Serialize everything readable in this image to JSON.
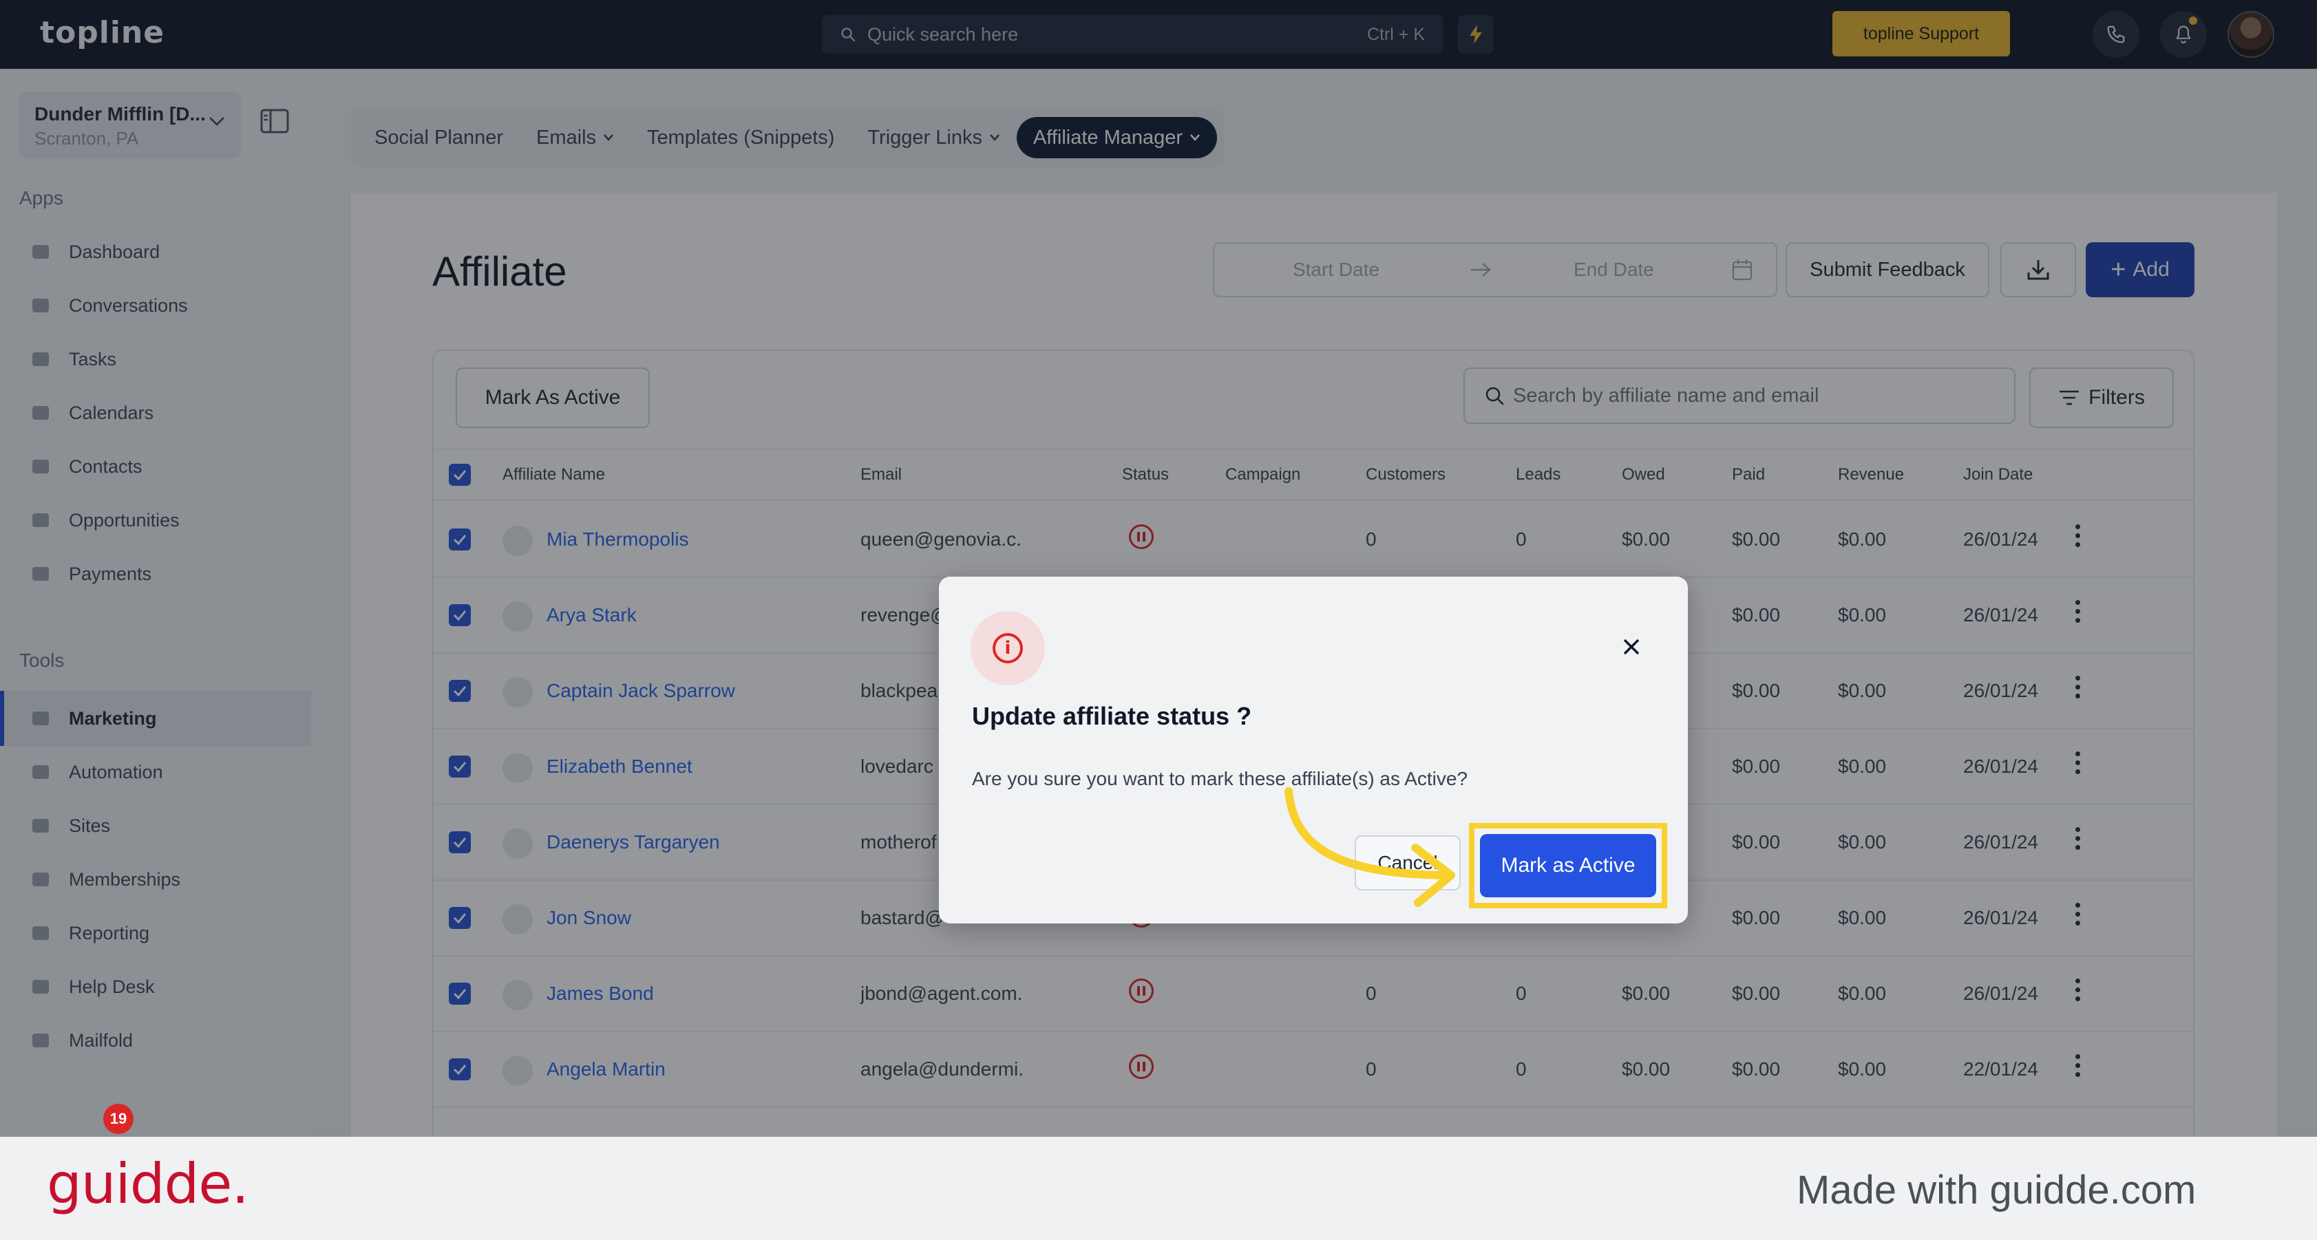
{
  "topbar": {
    "logo": "topline",
    "search_placeholder": "Quick search here",
    "search_shortcut": "Ctrl + K",
    "support_label": "topline Support"
  },
  "sidebar": {
    "org_name": "Dunder Mifflin [D...",
    "org_location": "Scranton, PA",
    "apps_heading": "Apps",
    "apps": [
      {
        "label": "Dashboard",
        "icon": "dashboard-icon"
      },
      {
        "label": "Conversations",
        "icon": "conversations-icon"
      },
      {
        "label": "Tasks",
        "icon": "tasks-icon"
      },
      {
        "label": "Calendars",
        "icon": "calendar-icon"
      },
      {
        "label": "Contacts",
        "icon": "contacts-icon"
      },
      {
        "label": "Opportunities",
        "icon": "opportunities-icon"
      },
      {
        "label": "Payments",
        "icon": "payments-icon"
      }
    ],
    "tools_heading": "Tools",
    "tools": [
      {
        "label": "Marketing",
        "icon": "megaphone-icon",
        "active": true
      },
      {
        "label": "Automation",
        "icon": "automation-icon"
      },
      {
        "label": "Sites",
        "icon": "sites-icon"
      },
      {
        "label": "Memberships",
        "icon": "memberships-icon"
      },
      {
        "label": "Reporting",
        "icon": "reporting-icon"
      },
      {
        "label": "Help Desk",
        "icon": "help-icon"
      },
      {
        "label": "Mailfold",
        "icon": "mailfold-icon"
      }
    ],
    "notification_count": "19"
  },
  "subnav": {
    "tabs": [
      {
        "label": "Social Planner",
        "dropdown": false
      },
      {
        "label": "Emails",
        "dropdown": true
      },
      {
        "label": "Templates (Snippets)",
        "dropdown": false
      },
      {
        "label": "Trigger Links",
        "dropdown": true
      },
      {
        "label": "Affiliate Manager",
        "dropdown": true,
        "active": true
      }
    ]
  },
  "page": {
    "title": "Affiliate",
    "start_date_placeholder": "Start Date",
    "end_date_placeholder": "End Date",
    "submit_feedback": "Submit Feedback",
    "add_label": "Add",
    "mark_active_button": "Mark As Active",
    "search_placeholder": "Search by affiliate name and email",
    "filters_label": "Filters"
  },
  "table": {
    "columns": [
      "Affiliate Name",
      "Email",
      "Status",
      "Campaign",
      "Customers",
      "Leads",
      "Owed",
      "Paid",
      "Revenue",
      "Join Date"
    ],
    "rows": [
      {
        "name": "Mia Thermopolis",
        "email": "queen@genovia.c.",
        "customers": "0",
        "leads": "0",
        "owed": "$0.00",
        "paid": "$0.00",
        "revenue": "$0.00",
        "join_date": "26/01/24"
      },
      {
        "name": "Arya Stark",
        "email": "revenge@",
        "customers": "",
        "leads": "",
        "owed": "",
        "paid": "$0.00",
        "revenue": "$0.00",
        "join_date": "26/01/24"
      },
      {
        "name": "Captain Jack Sparrow",
        "email": "blackpea",
        "customers": "",
        "leads": "",
        "owed": "",
        "paid": "$0.00",
        "revenue": "$0.00",
        "join_date": "26/01/24"
      },
      {
        "name": "Elizabeth Bennet",
        "email": "lovedarc",
        "customers": "",
        "leads": "",
        "owed": "",
        "paid": "$0.00",
        "revenue": "$0.00",
        "join_date": "26/01/24"
      },
      {
        "name": "Daenerys Targaryen",
        "email": "motherof",
        "customers": "",
        "leads": "",
        "owed": "",
        "paid": "$0.00",
        "revenue": "$0.00",
        "join_date": "26/01/24"
      },
      {
        "name": "Jon Snow",
        "email": "bastard@",
        "customers": "",
        "leads": "",
        "owed": "",
        "paid": "$0.00",
        "revenue": "$0.00",
        "join_date": "26/01/24"
      },
      {
        "name": "James Bond",
        "email": "jbond@agent.com.",
        "customers": "0",
        "leads": "0",
        "owed": "$0.00",
        "paid": "$0.00",
        "revenue": "$0.00",
        "join_date": "26/01/24"
      },
      {
        "name": "Angela Martin",
        "email": "angela@dundermi.",
        "customers": "0",
        "leads": "0",
        "owed": "$0.00",
        "paid": "$0.00",
        "revenue": "$0.00",
        "join_date": "22/01/24"
      }
    ]
  },
  "modal": {
    "title": "Update affiliate status ?",
    "body": "Are you sure you want to mark these affiliate(s) as Active?",
    "cancel_label": "Cancel",
    "confirm_label": "Mark as Active"
  },
  "footer": {
    "brand": "guidde.",
    "made_with": "Made with guidde.com"
  },
  "colors": {
    "topbar_bg": "#0e1525",
    "accent_blue": "#2552e0",
    "support_yellow": "#e9b62b",
    "highlight_yellow": "#f8d12f",
    "status_red": "#dc2626",
    "brand_red": "#c8102e"
  }
}
